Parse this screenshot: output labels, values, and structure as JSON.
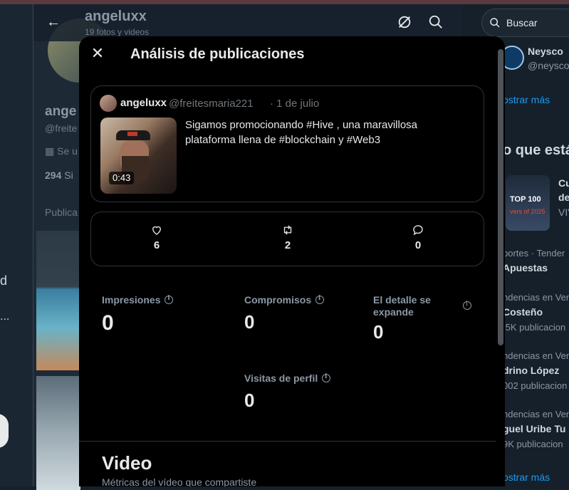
{
  "background": {
    "header": {
      "title": "angeluxx",
      "subtitle": "19 fotos y videos"
    },
    "profile": {
      "name": "ange",
      "handle": "@freite",
      "joined": "Se u",
      "following_count": "294",
      "following_label": "Si",
      "tab": "Publica"
    },
    "leftnav": {
      "letter": "d",
      "dots": "..."
    },
    "search": {
      "placeholder": "Buscar"
    },
    "right": {
      "neysco_name": "Neysco",
      "neysco_handle": "@neysco",
      "show_more_1": "ostrar más",
      "trends_heading": "o que está",
      "top100_text": "TOP 100",
      "top100_sub": "vers of 2025",
      "cu": "Cu",
      "de": "de",
      "viv": "VIV",
      "t1_cat": "portes · Tender",
      "t1_name": "Apuestas",
      "t2_cat": "ndencias en Ven",
      "t2_name": "Costeño",
      "t2_count": ".5K publicacion",
      "t3_cat": "ndencias en Ven",
      "t3_name": "drino López",
      "t3_count": "002 publicacion",
      "t4_cat": "ndencias en Ven",
      "t4_name": "guel Uribe Tu",
      "t4_count": "9K publicacion",
      "show_more_2": "ostrar más"
    }
  },
  "modal": {
    "title": "Análisis de publicaciones",
    "post": {
      "author_name": "angeluxx",
      "author_handle": "@freitesmaria221",
      "date": "· 1 de julio",
      "text": "Sigamos promocionando #Hive , una maravillosa plataforma llena de #blockchain y #Web3",
      "video_duration": "0:43"
    },
    "engagement": {
      "likes": "6",
      "reposts": "2",
      "replies": "0"
    },
    "metrics": {
      "impressions_label": "Impresiones",
      "impressions_value": "0",
      "engagements_label": "Compromisos",
      "engagements_value": "0",
      "detail_expands_label": "El detalle se expande",
      "detail_expands_value": "0",
      "profile_visits_label": "Visitas de perfil",
      "profile_visits_value": "0"
    },
    "video": {
      "title": "Video",
      "subtitle": "Métricas del vídeo que compartiste"
    }
  },
  "colors": {
    "accent": "#1d9bf0",
    "modal_bg": "#000000",
    "page_bg": "#15202b"
  }
}
